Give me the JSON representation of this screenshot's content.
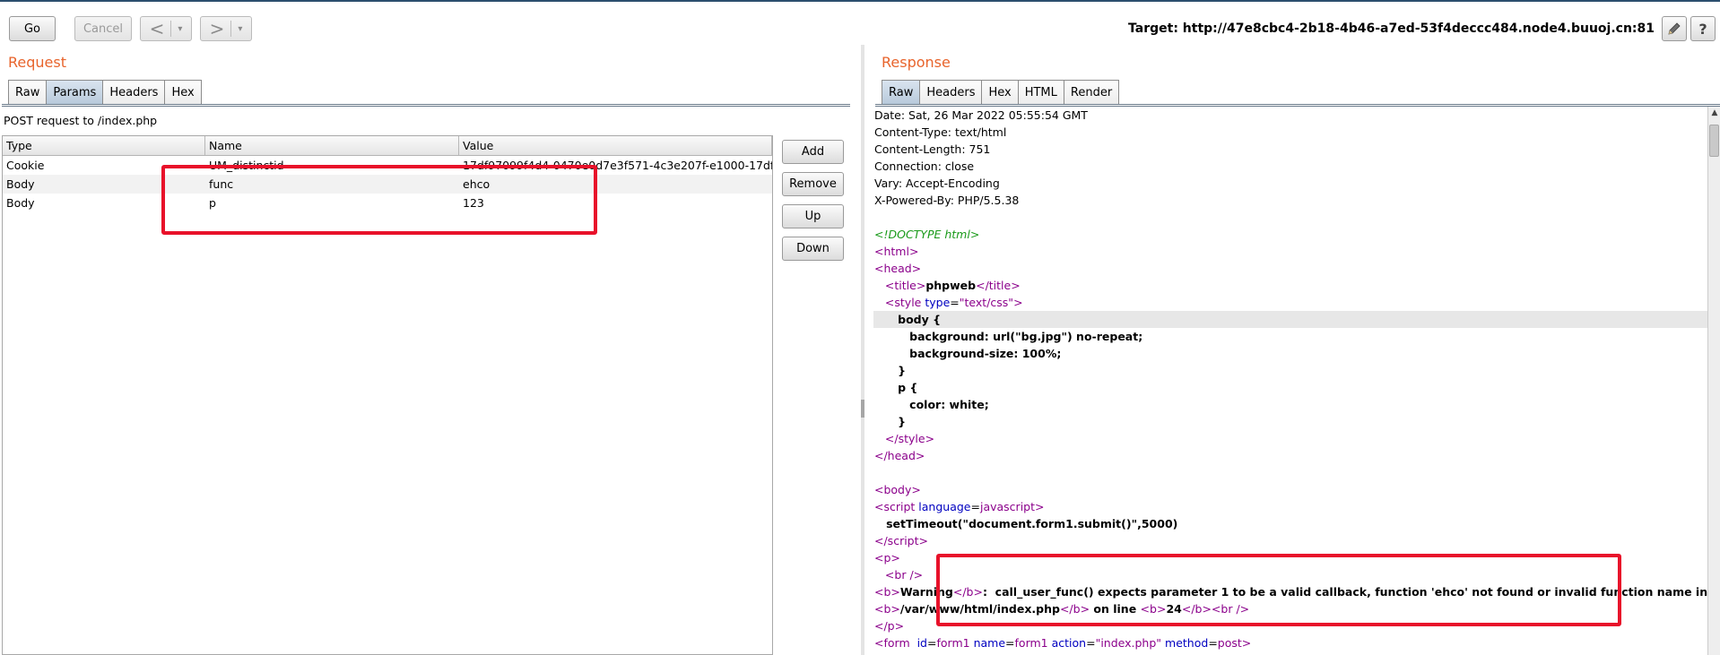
{
  "toolbar": {
    "go_label": "Go",
    "cancel_label": "Cancel",
    "back_glyph": "<",
    "forward_glyph": ">",
    "dropdown_glyph": "▾",
    "target_text": "Target: http://47e8cbc4-2b18-4b46-a7ed-53f4deccc484.node4.buuoj.cn:81",
    "edit_icon": "pencil-icon",
    "help_glyph": "?"
  },
  "request": {
    "title": "Request",
    "tabs": [
      "Raw",
      "Params",
      "Headers",
      "Hex"
    ],
    "active_tab": "Params",
    "post_label": "POST request to /index.php",
    "columns": [
      "Type",
      "Name",
      "Value"
    ],
    "rows": [
      {
        "type": "Cookie",
        "name": "UM_distinctid",
        "value": "17df97099f4d4-0470e0d7e3f571-4c3e207f-e1000-17df97..."
      },
      {
        "type": "Body",
        "name": "func",
        "value": "ehco"
      },
      {
        "type": "Body",
        "name": "p",
        "value": "123"
      }
    ],
    "buttons": {
      "add": "Add",
      "remove": "Remove",
      "up": "Up",
      "down": "Down"
    }
  },
  "response": {
    "title": "Response",
    "tabs": [
      "Raw",
      "Headers",
      "Hex",
      "HTML",
      "Render"
    ],
    "active_tab": "Raw",
    "headers": [
      "Date: Sat, 26 Mar 2022 05:55:54 GMT",
      "Content-Type: text/html",
      "Content-Length: 751",
      "Connection: close",
      "Vary: Accept-Encoding",
      "X-Powered-By: PHP/5.5.38"
    ],
    "doctype": "<!DOCTYPE html>",
    "page_title": "phpweb",
    "css_selector_body": "body {",
    "css_background": "background: url(\"bg.jpg\") no-repeat;",
    "css_background_size": "background-size: 100%;",
    "css_close": "}",
    "css_selector_p": "p {",
    "css_color": "color: white;",
    "script_language": "javascript",
    "script_code": "setTimeout(\"document.form1.submit()\",5000)",
    "warning_label": "Warning",
    "warning_message": ":  call_user_func() expects parameter 1 to be a valid callback, function 'ehco' not found or invalid function name in",
    "warning_path": "/var/www/html/index.php",
    "warning_line_text": " on line ",
    "warning_line_number": "24",
    "form_id": "form1",
    "form_name": "form1",
    "form_action": "\"index.php\"",
    "form_method": "post"
  },
  "colors": {
    "section_title": "#e8642c",
    "highlight_box": "#e8112a",
    "tag": "#8b008b",
    "attr_name": "#0000c0",
    "comment": "#1a9a1a"
  }
}
